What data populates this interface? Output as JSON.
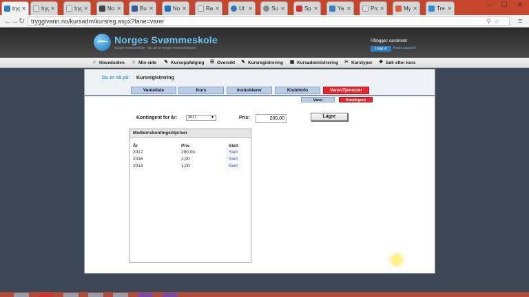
{
  "browser": {
    "tabs": [
      {
        "label": "tryggivann",
        "active": true,
        "color": "#2c7bd0"
      },
      {
        "label": "tryg",
        "color": "#e0e0e0"
      },
      {
        "label": "tryg",
        "color": "#e0e0e0"
      },
      {
        "label": "No",
        "color": "#444444"
      },
      {
        "label": "Bu",
        "color": "#3b5998"
      },
      {
        "label": "No",
        "color": "#1e6fc2"
      },
      {
        "label": "Ra",
        "color": "#e0e0e0"
      },
      {
        "label": "Ut",
        "color": "#2a7ab8"
      },
      {
        "label": "Su",
        "color": "#888888"
      },
      {
        "label": "Sp",
        "color": "#d32f2f"
      },
      {
        "label": "Ya",
        "color": "#3a7fc4"
      },
      {
        "label": "Pro",
        "color": "#e0e0e0"
      },
      {
        "label": "My",
        "color": "#e05a3a"
      },
      {
        "label": "Tre",
        "color": "#2a8fd0"
      }
    ],
    "url": "tryggivann.no/kursadm/kursreg.aspx?fane=varer",
    "window_controls": [
      "–",
      "☐",
      "✕"
    ]
  },
  "header": {
    "title": "Norges Svømmeskole",
    "tagline": "Norges Svømmeskole – En del av Norges Svømmeforbund",
    "login_text": "Pålogget: carolinebr",
    "logout_label": "Logg ut",
    "change_password_label": "Endre passord"
  },
  "menu": [
    {
      "label": "Hovedsiden",
      "icon": "home-icon",
      "glyph": "⌂"
    },
    {
      "label": "Min side",
      "icon": "person-icon",
      "glyph": "☺"
    },
    {
      "label": "Kursoppfølging",
      "icon": "pencil-icon",
      "glyph": "✎"
    },
    {
      "label": "Oversikt",
      "icon": "list-icon",
      "glyph": "☰"
    },
    {
      "label": "Kursregistrering",
      "icon": "edit-icon",
      "glyph": "✎"
    },
    {
      "label": "Kursadministrering",
      "icon": "briefcase-icon",
      "glyph": "▣"
    },
    {
      "label": "Kurstyper",
      "icon": "tag-icon",
      "glyph": "✂"
    },
    {
      "label": "Søk etter kurs",
      "icon": "search-icon",
      "glyph": "✚"
    }
  ],
  "breadcrumb": {
    "label": "Du er nå på:",
    "current": "Kursregistrering"
  },
  "tabs": [
    {
      "label": "Venteliste",
      "active": false
    },
    {
      "label": "Kurs",
      "active": false
    },
    {
      "label": "Instrukterer",
      "active": false
    },
    {
      "label": "Klubbinfo",
      "active": false
    },
    {
      "label": "Varer/Tjenester",
      "active": true
    }
  ],
  "subtabs": [
    {
      "label": "Varer",
      "active": false
    },
    {
      "label": "Kontingent",
      "active": true
    }
  ],
  "form": {
    "year_label": "Kontingent for år:",
    "year_value": "2017",
    "price_label": "Pris:",
    "price_value": "200,00",
    "save_label": "Lagre"
  },
  "price_table": {
    "title": "Medlemskontingentpriser",
    "columns": [
      "År",
      "Pris",
      "Slett"
    ],
    "rows": [
      {
        "year": "2017",
        "price": "200,00",
        "delete": "Slett"
      },
      {
        "year": "2016",
        "price": "2,00",
        "delete": "Slett"
      },
      {
        "year": "2013",
        "price": "1,00",
        "delete": "Slett"
      }
    ]
  },
  "colors": {
    "accent_red": "#e8262c",
    "tab_blue": "#b9cce8",
    "brand_blue": "#68c2f5",
    "link_blue": "#1d4fc4"
  }
}
